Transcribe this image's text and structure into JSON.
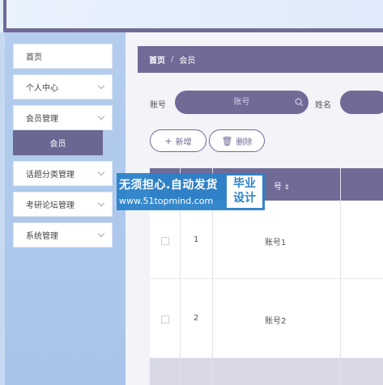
{
  "sidebar": {
    "items": [
      {
        "label": "首页"
      },
      {
        "label": "个人中心"
      },
      {
        "label": "会员管理"
      },
      {
        "label": "话题分类管理"
      },
      {
        "label": "考研论坛管理"
      },
      {
        "label": "系统管理"
      }
    ],
    "active_submenu": {
      "label": "会员"
    }
  },
  "breadcrumb": {
    "home": "首页",
    "separator": "/",
    "current": "会员"
  },
  "search": {
    "account_label": "账号",
    "account_placeholder": "账号",
    "name_label": "姓名"
  },
  "toolbar": {
    "add_label": "新增",
    "add_glyph": "+",
    "delete_label": "删除",
    "delete_glyph": "🗑"
  },
  "table": {
    "header_account_partial": "号",
    "sort_glyph": "⇕",
    "rows": [
      {
        "index": "1",
        "account": "账号1"
      },
      {
        "index": "2",
        "account": "账号2"
      }
    ]
  },
  "watermark": {
    "line1": "无须担心.自动发货",
    "line2": "www.51topmind.com",
    "badge_line1": "毕业",
    "badge_line2": "设计"
  },
  "colors": {
    "accent": "#6f6a96",
    "sidebar_bg": "#b4cdee",
    "watermark_blue": "#2b82c9"
  }
}
